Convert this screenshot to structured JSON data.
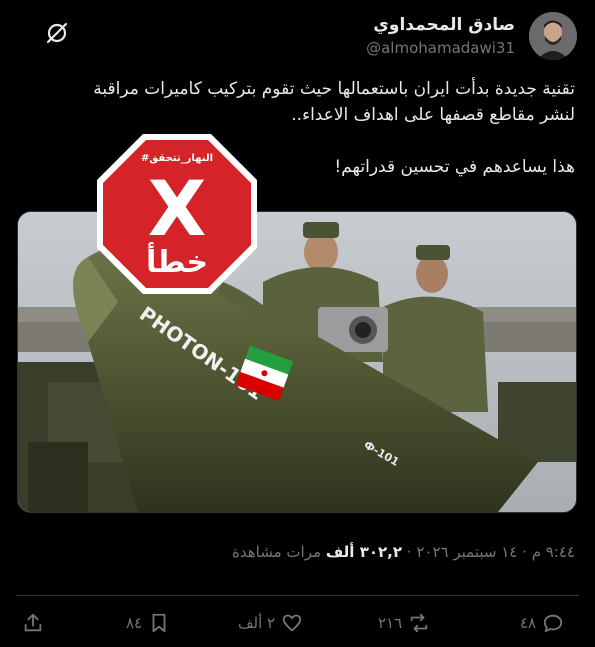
{
  "author": {
    "name": "صادق المحمداوي",
    "handle": "@almohamadawi31"
  },
  "tweet": {
    "line1": "تقنية جديدة بدأت ايران باستعمالها حيث تقوم بتركيب كاميرات مراقبة",
    "line2": "لنشر مقاطع قصفها على اهداف الاعداء..",
    "line3": "هذا يساعدهم في تحسين قدراتهم!"
  },
  "media": {
    "missile_label": "PHOTON-101",
    "missile_side_label": "Ф-101",
    "stamp_top_text": "#النهار_تتحقق",
    "stamp_letter": "X",
    "stamp_word": "خطأ"
  },
  "meta": {
    "time": "٩:٤٤ م",
    "separator": "·",
    "date": "١٤ سبتمبر ٢٠٢٦",
    "views_count": "٣٠٢,٢ ألف",
    "views_label": "مرات مشاهدة"
  },
  "actions": {
    "replies": "٤٨",
    "reposts": "٢١٦",
    "likes": "٢ ألف",
    "bookmarks": "٨٤"
  },
  "icons": [
    "grok-icon",
    "reply-icon",
    "repost-icon",
    "like-icon",
    "bookmark-icon",
    "share-icon"
  ],
  "colors": {
    "background": "#000000",
    "text": "#e7e9ea",
    "muted": "#71767b",
    "stamp_red": "#d4242a"
  }
}
